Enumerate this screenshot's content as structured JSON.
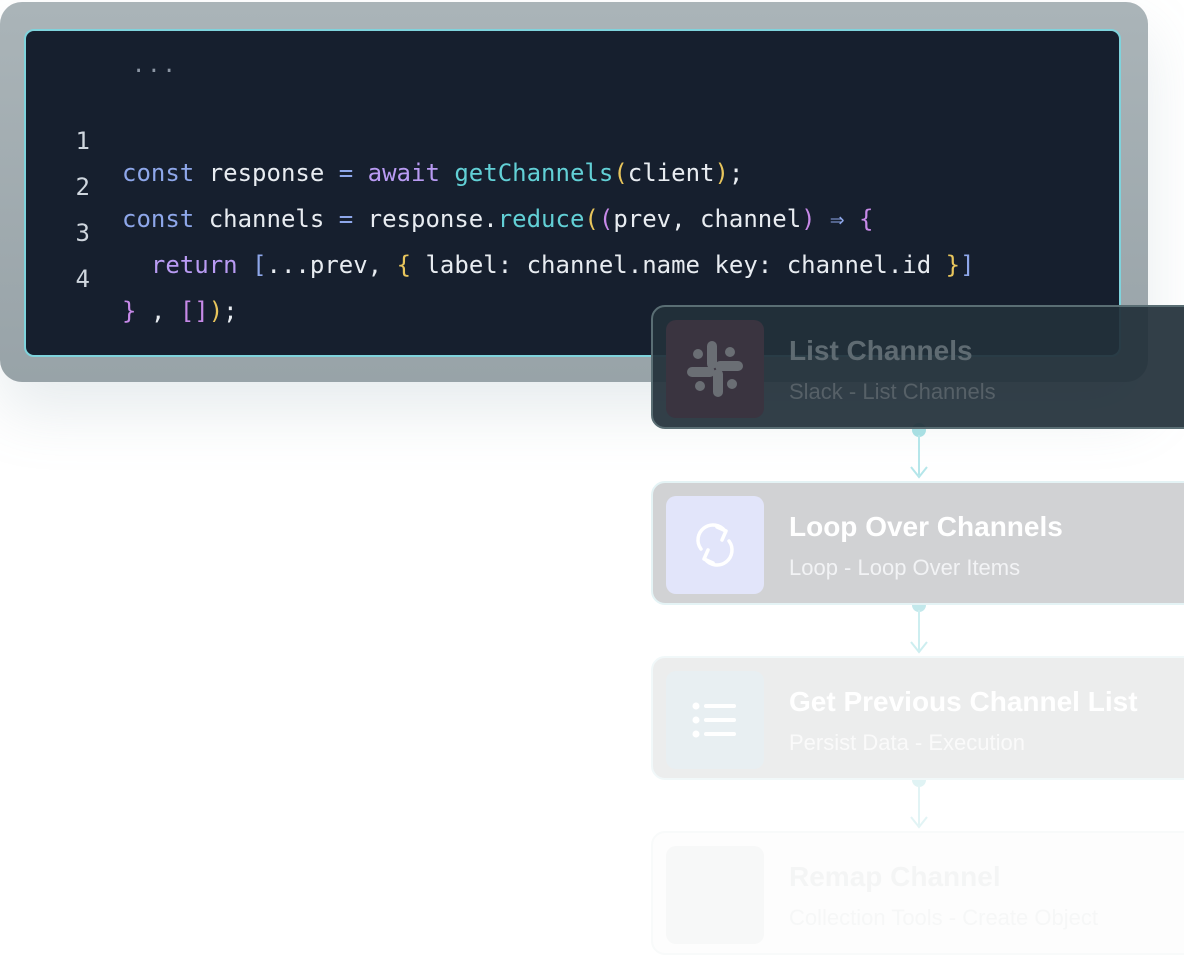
{
  "code": {
    "ellipsis": "...",
    "lines": [
      {
        "num": "1",
        "t": [
          "const",
          " response ",
          "=",
          " ",
          "await",
          " ",
          "getChannels",
          "(",
          "client",
          ")",
          ";"
        ]
      },
      {
        "num": "2",
        "t": [
          "const",
          " channels ",
          "=",
          " response.",
          "reduce",
          "(",
          "(",
          "prev, channel",
          ")",
          " ⇒ ",
          "{"
        ]
      },
      {
        "num": "3",
        "t": [
          "  ",
          "return",
          " ",
          "[",
          "...prev, ",
          "{",
          " label: channel.name key: channel.id ",
          "}",
          "]"
        ]
      },
      {
        "num": "4",
        "t": [
          "}",
          " , ",
          "[",
          "]",
          ")",
          ";"
        ]
      }
    ]
  },
  "workflow": {
    "nodes": [
      {
        "title": "List Channels",
        "subtitle": "Slack - List Channels",
        "icon": "slack-icon"
      },
      {
        "title": "Loop Over Channels",
        "subtitle": "Loop - Loop Over Items",
        "icon": "loop-icon"
      },
      {
        "title": "Get Previous Channel List",
        "subtitle": "Persist Data - Execution",
        "icon": "list-icon"
      },
      {
        "title": "Remap Channel",
        "subtitle": "Collection Tools - Create Object",
        "icon": "remap-icon"
      }
    ]
  },
  "colors": {
    "code_bg": "#161f2e",
    "code_border": "#7fd3dc",
    "keyword": "#8ea7ea",
    "await": "#b99bf3",
    "function": "#62d0d6",
    "bracket_yellow": "#e8c55c",
    "bracket_purple": "#c789e8",
    "connector": "#b5e6ea"
  }
}
